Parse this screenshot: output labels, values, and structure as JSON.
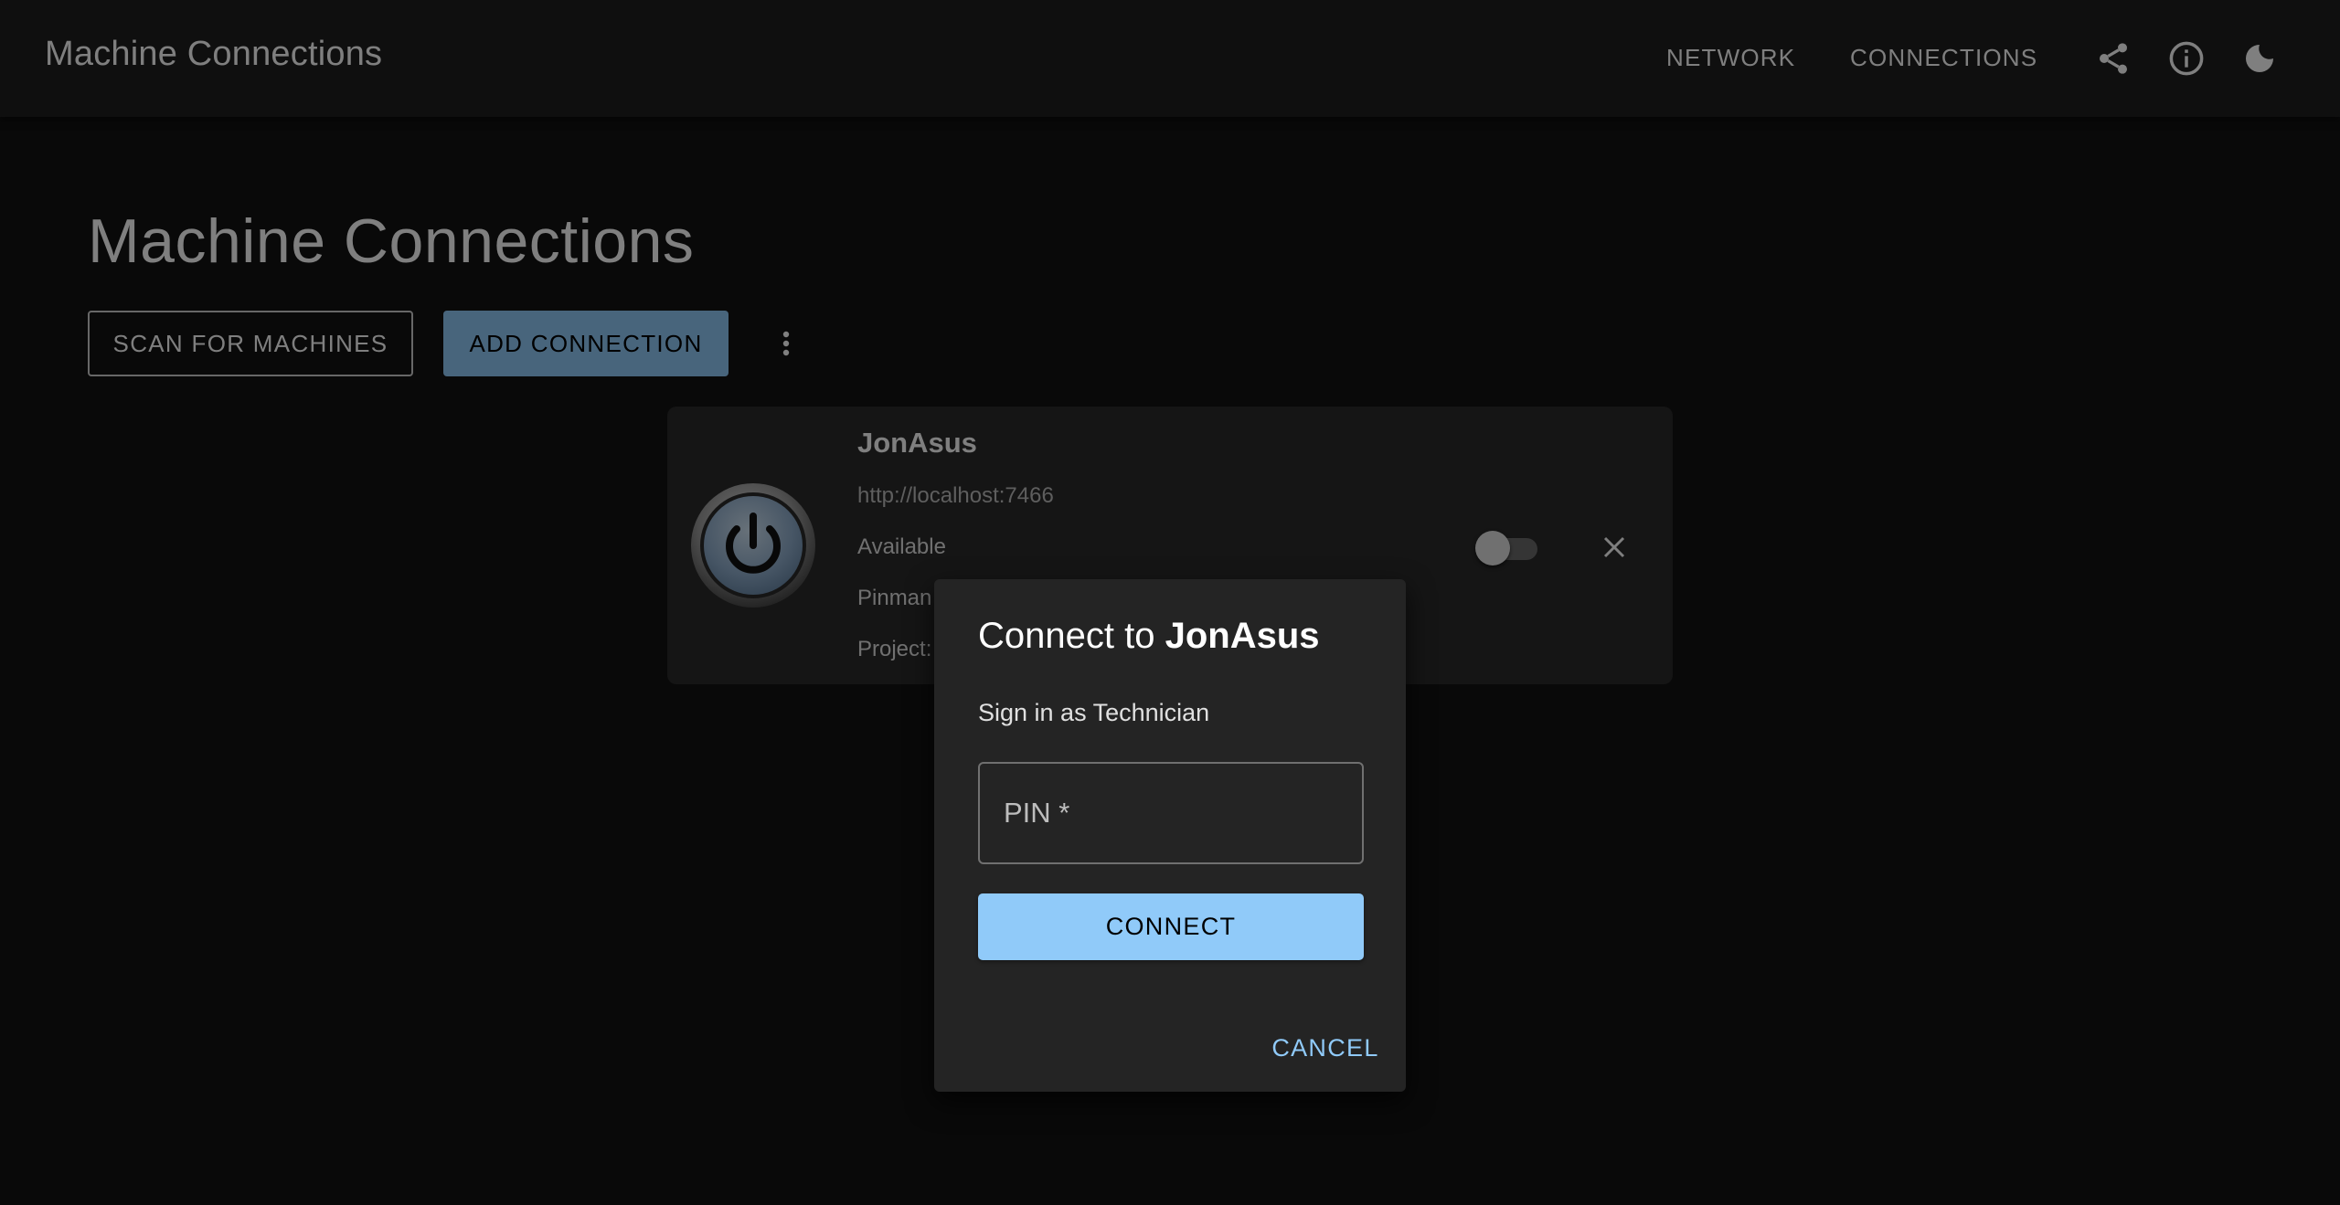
{
  "appbar": {
    "title": "Machine Connections",
    "nav": [
      "NETWORK",
      "CONNECTIONS"
    ],
    "icons": [
      "share-icon",
      "info-icon",
      "moon-icon"
    ]
  },
  "page": {
    "title": "Machine Connections",
    "scan_label": "SCAN FOR MACHINES",
    "add_label": "ADD CONNECTION",
    "more_icon": "more-vert-icon"
  },
  "machine": {
    "name": "JonAsus",
    "url": "http://localhost:7466",
    "status": "Available",
    "line3": "Pinman",
    "line4": "Project:",
    "toggle_on": false
  },
  "dialog": {
    "title_prefix": "Connect to ",
    "title_name": "JonAsus",
    "subtitle": "Sign in as Technician",
    "pin_label": "PIN *",
    "pin_value": "",
    "connect_label": "CONNECT",
    "cancel_label": "CANCEL"
  },
  "colors": {
    "background": "#121212",
    "appbar": "#1e1e1e",
    "card": "#2a2a2a",
    "dialog": "#242424",
    "accent": "#90caf9"
  }
}
